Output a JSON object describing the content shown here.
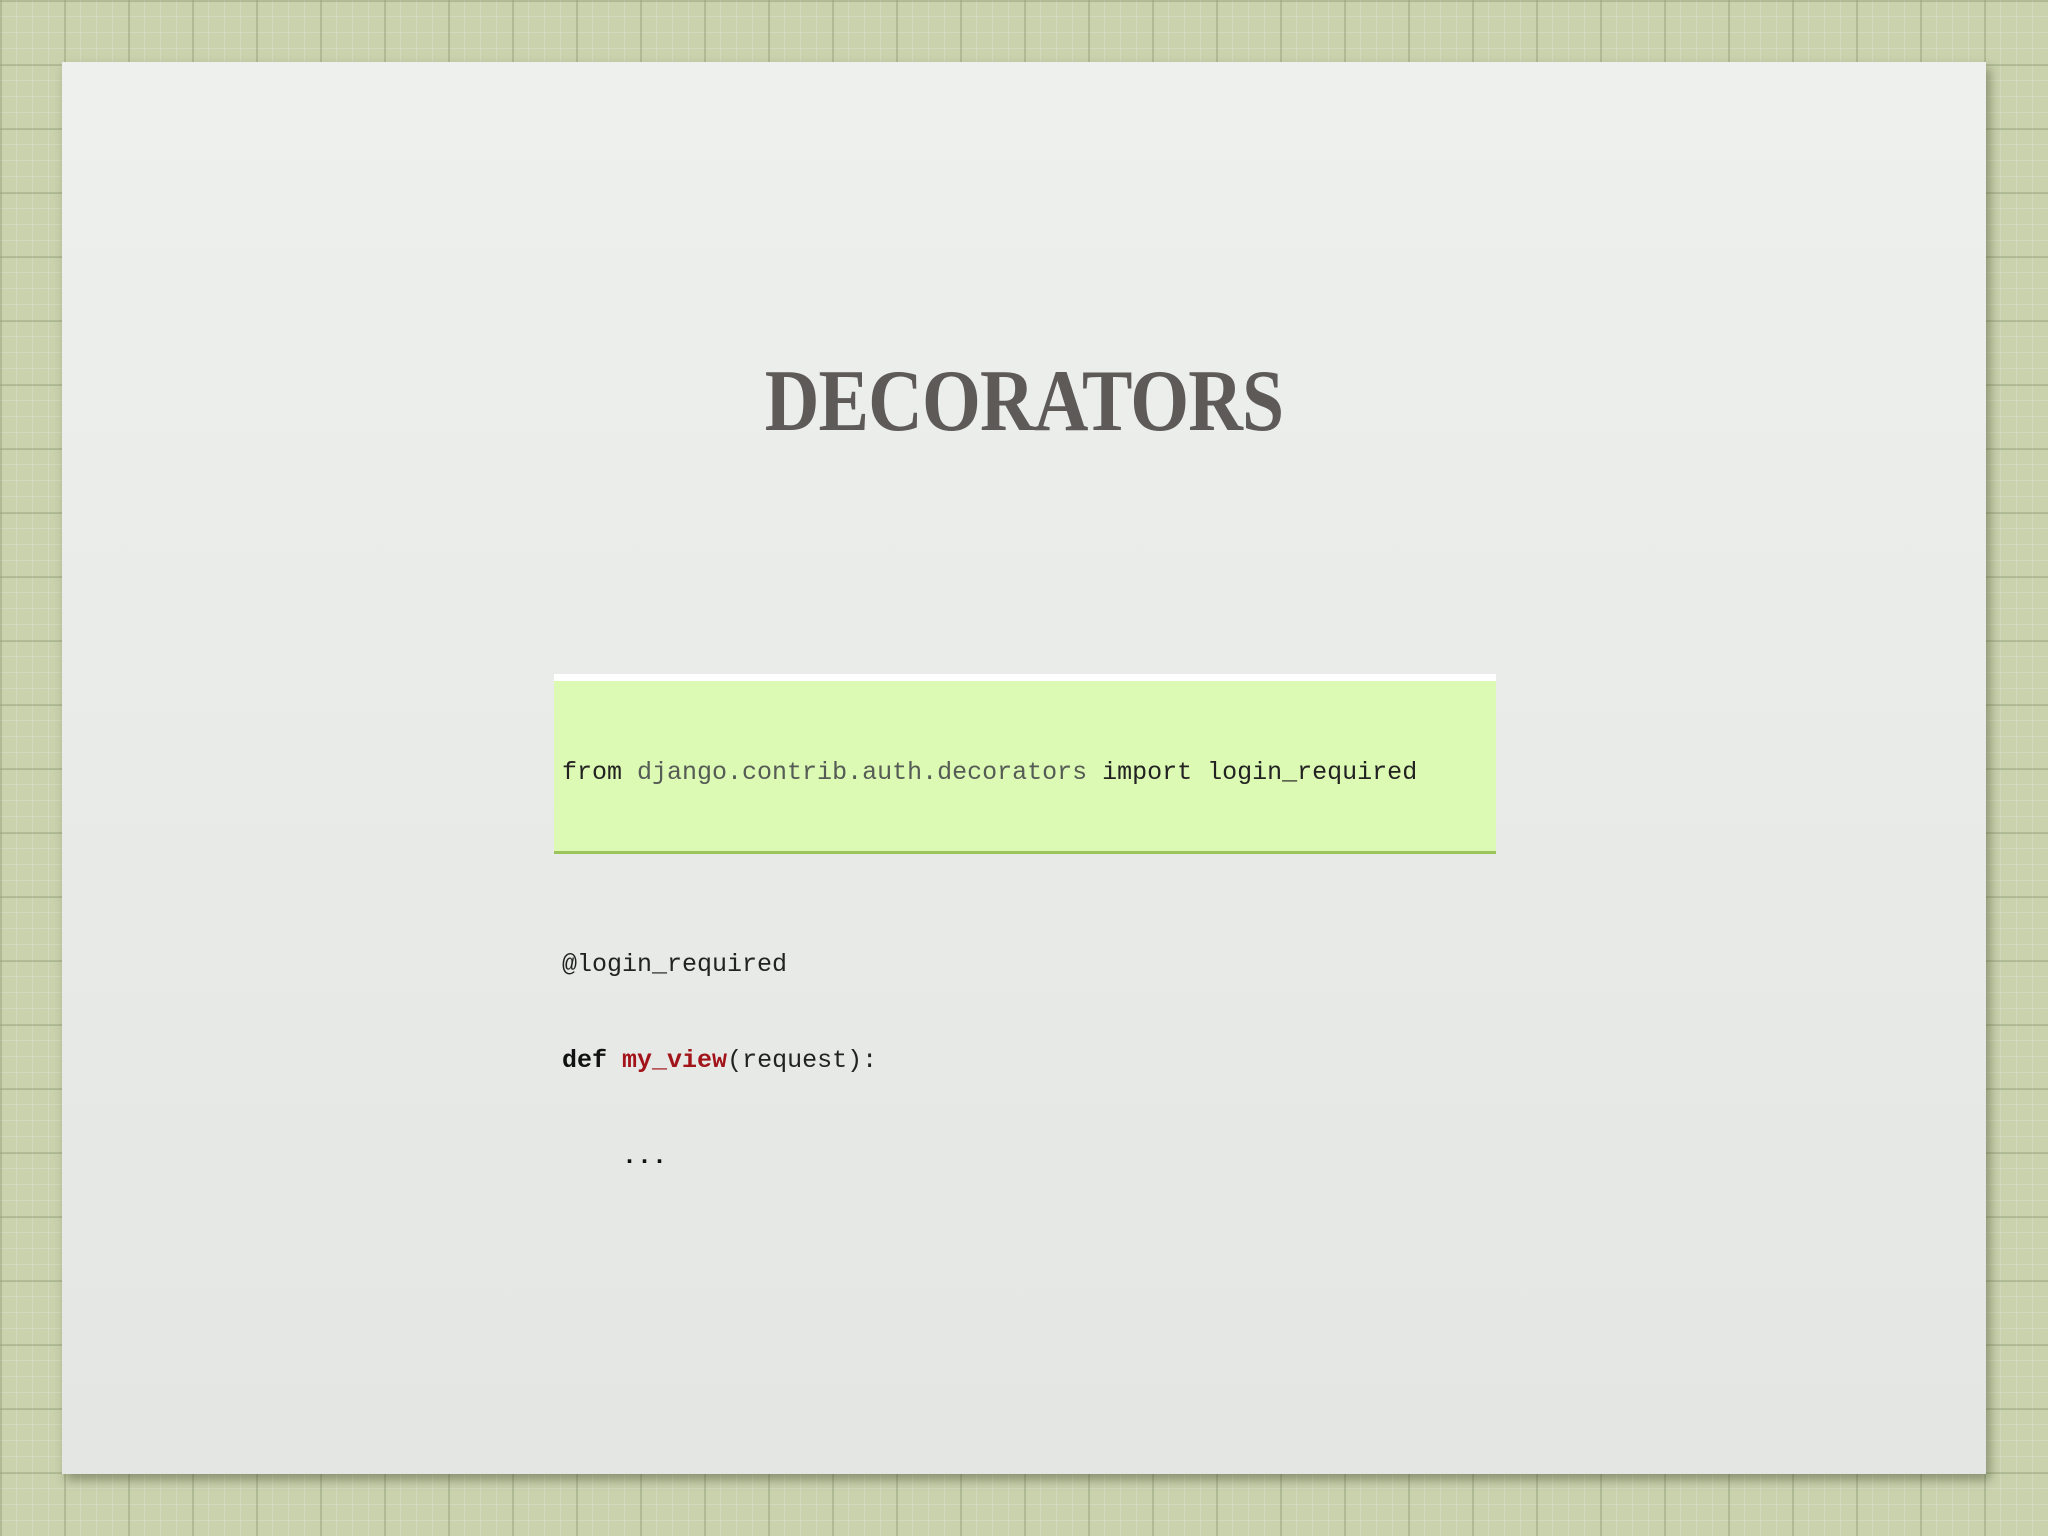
{
  "slide": {
    "title": "DECORATORS"
  },
  "code": {
    "line1": {
      "kw_from": "from",
      "module": "django.contrib.auth.decorators",
      "kw_import": "import",
      "name": "login_required"
    },
    "line3": {
      "decorator": "@login_required"
    },
    "line4": {
      "kw_def": "def",
      "func": "my_view",
      "args": "(request):"
    },
    "line5": {
      "body": "..."
    }
  },
  "colors": {
    "code_background": "#ddfab4",
    "function_name": "#a3141a",
    "title": "#5d5a58"
  }
}
